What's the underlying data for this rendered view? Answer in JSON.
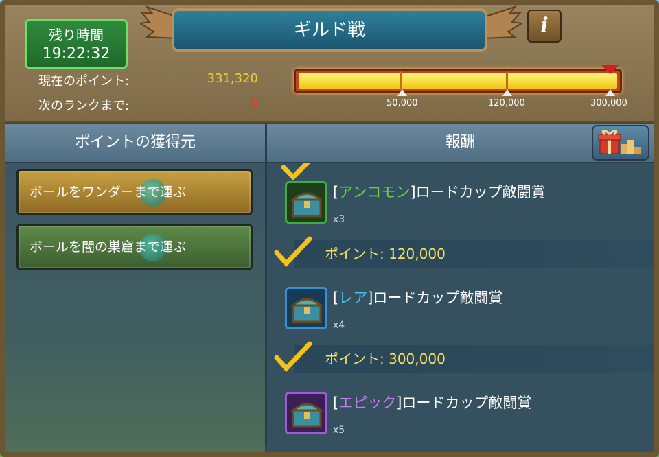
{
  "header": {
    "title": "ギルド戦",
    "info_label": "i"
  },
  "timer": {
    "label": "残り時間",
    "value": "19:22:32"
  },
  "stats": {
    "current_points_label": "現在のポイント:",
    "current_points_value": "331,320",
    "next_rank_label": "次のランクまで:",
    "next_rank_value": "0"
  },
  "progress": {
    "fill_fraction": 1.0,
    "milestones": [
      "50,000",
      "120,000",
      "300,000"
    ]
  },
  "columns": {
    "sources_header": "ポイントの獲得元",
    "rewards_header": "報酬"
  },
  "sources": [
    {
      "label": "ボールをワンダーまで運ぶ"
    },
    {
      "label": "ボールを闇の巣窟まで運ぶ"
    }
  ],
  "rewards": [
    {
      "rarity": "アンコモン",
      "name": "ロードカップ敵闘賞",
      "qty": "x3"
    },
    {
      "points_label": "ポイント: 120,000",
      "rarity": "レア",
      "name": "ロードカップ敵闘賞",
      "qty": "x4"
    },
    {
      "points_label": "ポイント: 300,000",
      "rarity": "エピック",
      "name": "ロードカップ敵闘賞",
      "qty": "x5"
    }
  ],
  "colors": {
    "uncommon": "#5edb4a",
    "rare": "#4ec0e8",
    "epic": "#c67de8",
    "points_text": "#f7e35a",
    "next_rank_value": "#e63a2a",
    "current_points_value": "#f0d23a"
  }
}
